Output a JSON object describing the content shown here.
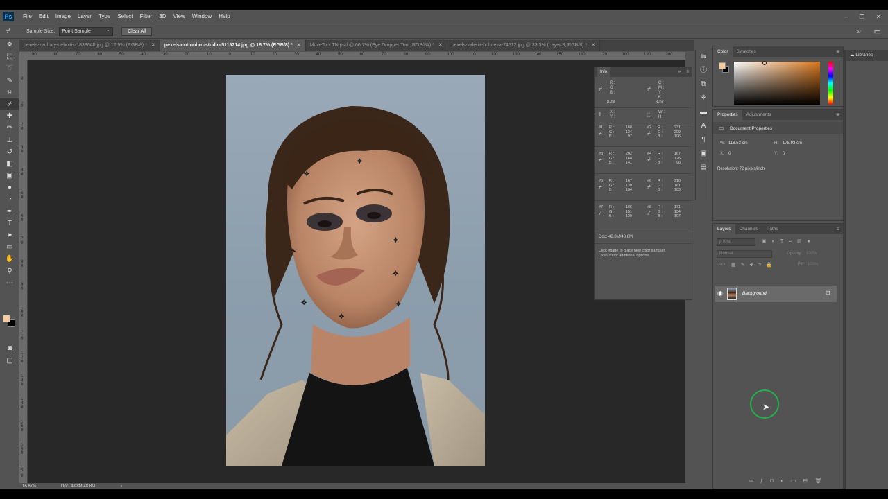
{
  "app": {
    "logo": "Ps"
  },
  "menu": [
    "File",
    "Edit",
    "Image",
    "Layer",
    "Type",
    "Select",
    "Filter",
    "3D",
    "View",
    "Window",
    "Help"
  ],
  "window_controls": {
    "minimize": "‒",
    "restore": "❐",
    "close": "✕"
  },
  "options_bar": {
    "tool_icon": "eyedropper-icon",
    "sample_size_label": "Sample Size:",
    "sample_size_value": "Point Sample",
    "clear_all": "Clear All"
  },
  "tabs": [
    {
      "label": "pexels-zachary-debottis-1838640.jpg @ 12.5% (RGB/8) *",
      "active": false
    },
    {
      "label": "pexels-cottonbro-studio-5119214.jpg @ 16.7% (RGB/8) *",
      "active": true
    },
    {
      "label": "MoveTool TN.psd @ 66.7% (Eye Dropper Tool, RGB/8#) *",
      "active": false
    },
    {
      "label": "pexels-valeria-boltneva-74512.jpg @ 33.3% (Layer 3, RGB/8) *",
      "active": false
    }
  ],
  "ruler_top": [
    "90",
    "80",
    "70",
    "60",
    "50",
    "40",
    "30",
    "20",
    "10",
    "0",
    "10",
    "20",
    "30",
    "40",
    "50",
    "60",
    "70",
    "80",
    "90",
    "100",
    "110",
    "120",
    "130",
    "140",
    "150",
    "160",
    "170",
    "180",
    "190",
    "200"
  ],
  "ruler_left": [
    "0",
    "1 0",
    "2 0",
    "3 0",
    "4 0",
    "5 0",
    "6 0",
    "7 0",
    "8 0",
    "9 0",
    "1 0 0",
    "1 1 0",
    "1 2 0",
    "1 3 0",
    "1 4 0",
    "1 5 0",
    "1 6 0",
    "1 7 0"
  ],
  "status": {
    "zoom": "16.67%",
    "doc": "Doc: 48.8M/48.8M",
    "arrow": "›"
  },
  "info_panel": {
    "title": "Info",
    "rgb_labels": [
      "R :",
      "G :",
      "B :"
    ],
    "cmyk_labels": [
      "C :",
      "M :",
      "Y :",
      "K :"
    ],
    "bit_left": "8-bit",
    "bit_right": "8-bit",
    "xy_labels": [
      "X :",
      "Y :"
    ],
    "wh_labels": [
      "W :",
      "H :"
    ],
    "samplers": [
      {
        "n": "#1",
        "r": "168",
        "g": "124",
        "b": "97"
      },
      {
        "n": "#2",
        "r": "231",
        "g": "209",
        "b": "196"
      },
      {
        "n": "#3",
        "r": "202",
        "g": "168",
        "b": "141"
      },
      {
        "n": "#4",
        "r": "167",
        "g": "126",
        "b": "98"
      },
      {
        "n": "#5",
        "r": "167",
        "g": "130",
        "b": "104"
      },
      {
        "n": "#6",
        "r": "210",
        "g": "181",
        "b": "163"
      },
      {
        "n": "#7",
        "r": "186",
        "g": "151",
        "b": "129"
      },
      {
        "n": "#8",
        "r": "171",
        "g": "134",
        "b": "107"
      }
    ],
    "doc": "Doc: 48.8M/48.8M",
    "hint_line1": "Click image to place new color sampler.",
    "hint_line2": "Use Ctrl for additional options."
  },
  "color_panel": {
    "tabs": [
      "Color",
      "Swatches"
    ],
    "fg": "#f6c99e",
    "bg": "#000000",
    "picker_hue": "#d9761c"
  },
  "properties_panel": {
    "tabs": [
      "Properties",
      "Adjustments"
    ],
    "title": "Document Properties",
    "w_label": "W:",
    "w_value": "118.53 cm",
    "h_label": "H:",
    "h_value": "178.93 cm",
    "x_label": "X:",
    "x_value": "0",
    "y_label": "Y:",
    "y_value": "0",
    "resolution": "Resolution: 72 pixels/inch"
  },
  "layers_panel": {
    "tabs": [
      "Layers",
      "Channels",
      "Paths"
    ],
    "filter_placeholder": "ρ Kind",
    "blend_mode": "Normal",
    "opacity_label": "Opacity:",
    "opacity_value": "100%",
    "lock_label": "Lock:",
    "fill_label": "Fill:",
    "fill_value": "100%",
    "layer_name": "Background"
  },
  "libraries": {
    "title": "Libraries"
  }
}
